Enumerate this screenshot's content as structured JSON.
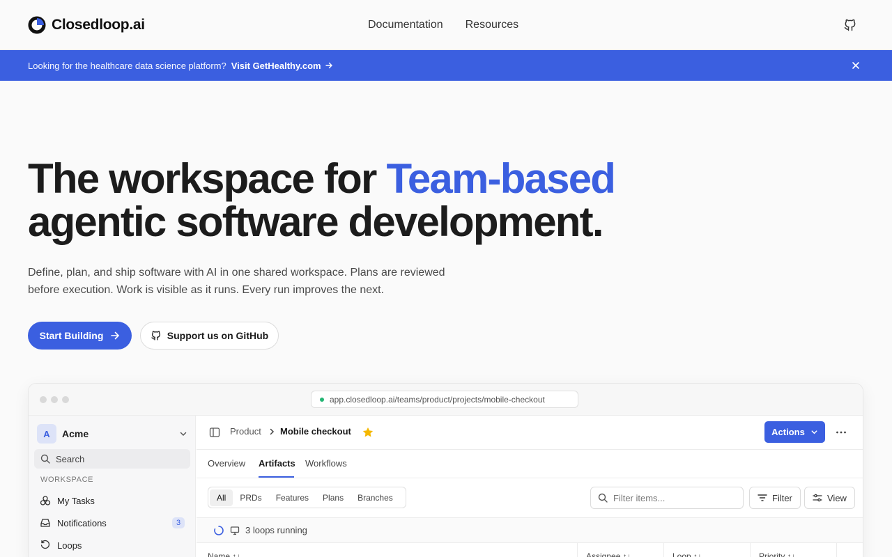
{
  "header": {
    "logo_text": "Closedloop.ai",
    "nav": [
      "Documentation",
      "Resources"
    ]
  },
  "banner": {
    "text": "Looking for the healthcare data science platform?",
    "link": "Visit GetHealthy.com"
  },
  "hero": {
    "title_pre": "The workspace for ",
    "title_accent": "Team-based",
    "title_line2": "agentic software development.",
    "subtitle": "Define, plan, and ship software with AI in one shared workspace. Plans are reviewed before execution. Work is visible as it runs. Every run improves the next.",
    "primary_cta": "Start Building",
    "secondary_cta": "Support us on GitHub"
  },
  "app": {
    "url": "app.closedloop.ai/teams/product/projects/mobile-checkout",
    "workspace": {
      "initial": "A",
      "name": "Acme"
    },
    "search_label": "Search",
    "section_label": "WORKSPACE",
    "nav_items": [
      {
        "label": "My Tasks"
      },
      {
        "label": "Notifications",
        "badge": "3"
      },
      {
        "label": "Loops"
      }
    ],
    "breadcrumb": {
      "parent": "Product",
      "current": "Mobile checkout"
    },
    "actions_label": "Actions",
    "tabs": [
      "Overview",
      "Artifacts",
      "Workflows"
    ],
    "active_tab": "Artifacts",
    "segments": [
      "All",
      "PRDs",
      "Features",
      "Plans",
      "Branches"
    ],
    "active_segment": "All",
    "filter_placeholder": "Filter items...",
    "filter_label": "Filter",
    "view_label": "View",
    "running_text": "3 loops running",
    "columns": [
      "Name ↑↓",
      "Assignee ↑↓",
      "Loop ↑↓",
      "Priority ↑↓"
    ]
  },
  "colors": {
    "accent": "#3b5fe0",
    "status_green": "#22b573",
    "star": "#f5b800"
  }
}
